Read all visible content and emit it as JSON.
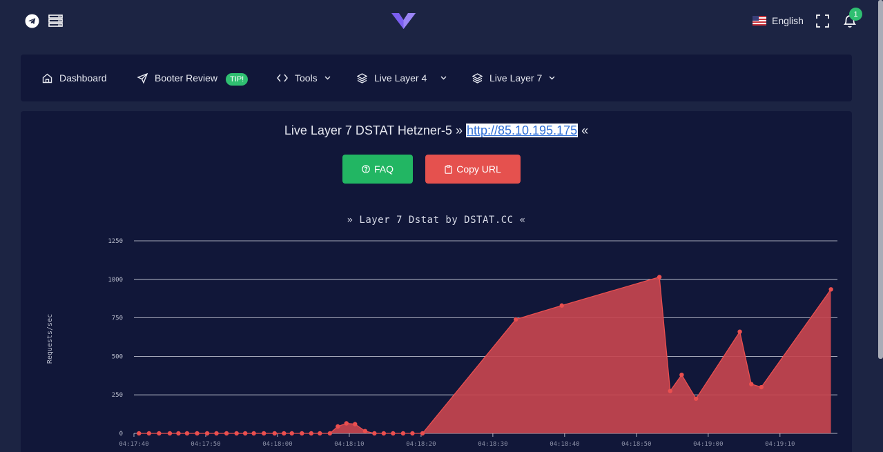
{
  "topbar": {
    "language": "English",
    "notification_count": "1",
    "icons": [
      "telegram-icon",
      "servers-icon",
      "brand-logo",
      "us-flag-icon",
      "fullscreen-icon",
      "bell-icon"
    ]
  },
  "nav": {
    "items": [
      {
        "label": "Dashboard",
        "icon": "home-icon"
      },
      {
        "label": "Booter Review",
        "icon": "send-icon",
        "badge": "TIP!"
      },
      {
        "label": "Tools",
        "icon": "code-icon"
      },
      {
        "label": "Live Layer 4",
        "icon": "layers-icon"
      },
      {
        "label": "Live Layer 7",
        "icon": "layers-icon"
      }
    ]
  },
  "page": {
    "title_prefix": "Live Layer 7 DSTAT Hetzner-5 »",
    "url": "http://85.10.195.175",
    "title_suffix": "«",
    "faq_label": "FAQ",
    "copy_label": "Copy URL"
  },
  "colors": {
    "background": "#1c2443",
    "panel": "#111739",
    "green": "#22b663",
    "red": "#e5514e",
    "series_fill": "#c5454f",
    "series_line": "#ea4f4f"
  },
  "chart_data": {
    "type": "area",
    "title": "» Layer 7 Dstat by DSTAT.CC «",
    "ylabel": "Requests/sec",
    "xlabel": "",
    "ylim": [
      0,
      1250
    ],
    "yticks": [
      "0",
      "250",
      "500",
      "750",
      "1000",
      "1250"
    ],
    "xticks": [
      "04:17:40",
      "04:17:50",
      "04:18:00",
      "04:18:10",
      "04:18:20",
      "04:18:30",
      "04:18:40",
      "04:18:50",
      "04:19:00",
      "04:19:10"
    ],
    "grid": true,
    "series": [
      {
        "x": [
          "04:17:40.7",
          "04:17:42.1",
          "04:17:43.5",
          "04:17:45.0",
          "04:17:46.2",
          "04:17:47.4",
          "04:17:48.8",
          "04:17:50.2",
          "04:17:51.5",
          "04:17:52.9",
          "04:17:54.3",
          "04:17:55.5",
          "04:17:56.7",
          "04:17:58.1",
          "04:17:59.6",
          "04:18:00.9",
          "04:18:02.0",
          "04:18:03.4",
          "04:18:04.7",
          "04:18:05.9",
          "04:18:07.3",
          "04:18:08.4",
          "04:18:09.6",
          "04:18:10.8",
          "04:18:12.2",
          "04:18:13.5",
          "04:18:14.8",
          "04:18:16.1",
          "04:18:17.5",
          "04:18:18.8",
          "04:18:20.2",
          "04:18:33.2",
          "04:18:39.6",
          "04:18:53.2",
          "04:18:54.7",
          "04:18:56.3",
          "04:18:58.3",
          "04:19:04.4",
          "04:19:06.0",
          "04:19:07.4",
          "04:19:17.1"
        ],
        "y": [
          0,
          0,
          0,
          0,
          0,
          0,
          0,
          0,
          0,
          0,
          0,
          0,
          0,
          0,
          0,
          0,
          0,
          0,
          0,
          0,
          0,
          45,
          65,
          60,
          15,
          0,
          0,
          0,
          0,
          0,
          0,
          740,
          830,
          1015,
          275,
          380,
          225,
          660,
          320,
          300,
          935
        ]
      }
    ]
  }
}
